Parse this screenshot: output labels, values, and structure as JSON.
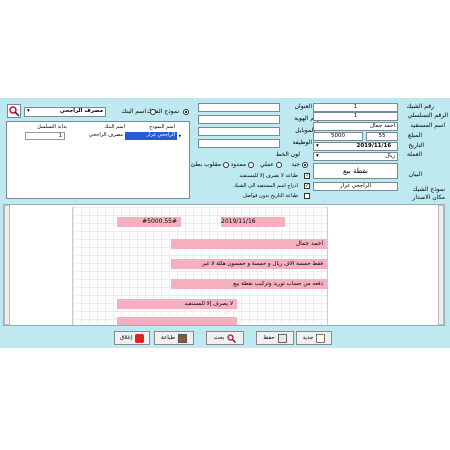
{
  "left_panel": {
    "search_value": "مصرف الراجحي",
    "radio_type": "نموذج الشيك",
    "radio_bank": "اسم البنك",
    "table_headers": [
      "بداية التسلسل",
      "اسم البنك",
      "اسم النموذج"
    ],
    "table_row": [
      "1",
      "مصرف الراجحي",
      "الراجحي غرار"
    ]
  },
  "form": {
    "labels": {
      "title": "العنوان",
      "id_number": "رقم الهوية",
      "mobile": "الموبايل",
      "job": "الوظيفة",
      "line_color": "لون الخط",
      "check_number": "رقم الشيك",
      "serial": "الرقم التسلسلي",
      "beneficiary": "اسم المستفيد",
      "amount": "المبلغ",
      "date": "التاريخ",
      "currency": "العملة",
      "statement": "البيان",
      "check_model": "نموذج الشيك",
      "issue_place": "مكان الاصدار"
    },
    "values": {
      "check_number": "1",
      "serial": "1",
      "beneficiary": "احمد جمال",
      "amount_decimal": "55",
      "amount_integer": "5000",
      "date": "2019/11/16",
      "currency": "ريال",
      "statement": "نقطة بيع",
      "check_model": "الراجحي غرار"
    },
    "color_options": [
      "جيد",
      "عملي",
      "ممدود",
      "مقلوب بطئ"
    ],
    "options": [
      "طباعة لا يصرف إلا للمستفيد",
      "ادراج اسم المستفيد الى الشيك",
      "طباعة التاريخ بدون فواصل"
    ]
  },
  "preview": {
    "amount": "#5000.55#",
    "date": "2019/11/16",
    "beneficiary": "احمد جمال",
    "amount_words": "فقط خمسة الاف ريال و خمسة و خمسون هللة لا غير",
    "statement": "دفعه من حساب توريد وتركيب نقطة بيع",
    "note": "لا يصرف إلا للمستفيد"
  },
  "buttons": {
    "new": "جديد",
    "save": "حفظ",
    "search": "بحث",
    "print": "طباعة",
    "close": "إغلاق"
  }
}
